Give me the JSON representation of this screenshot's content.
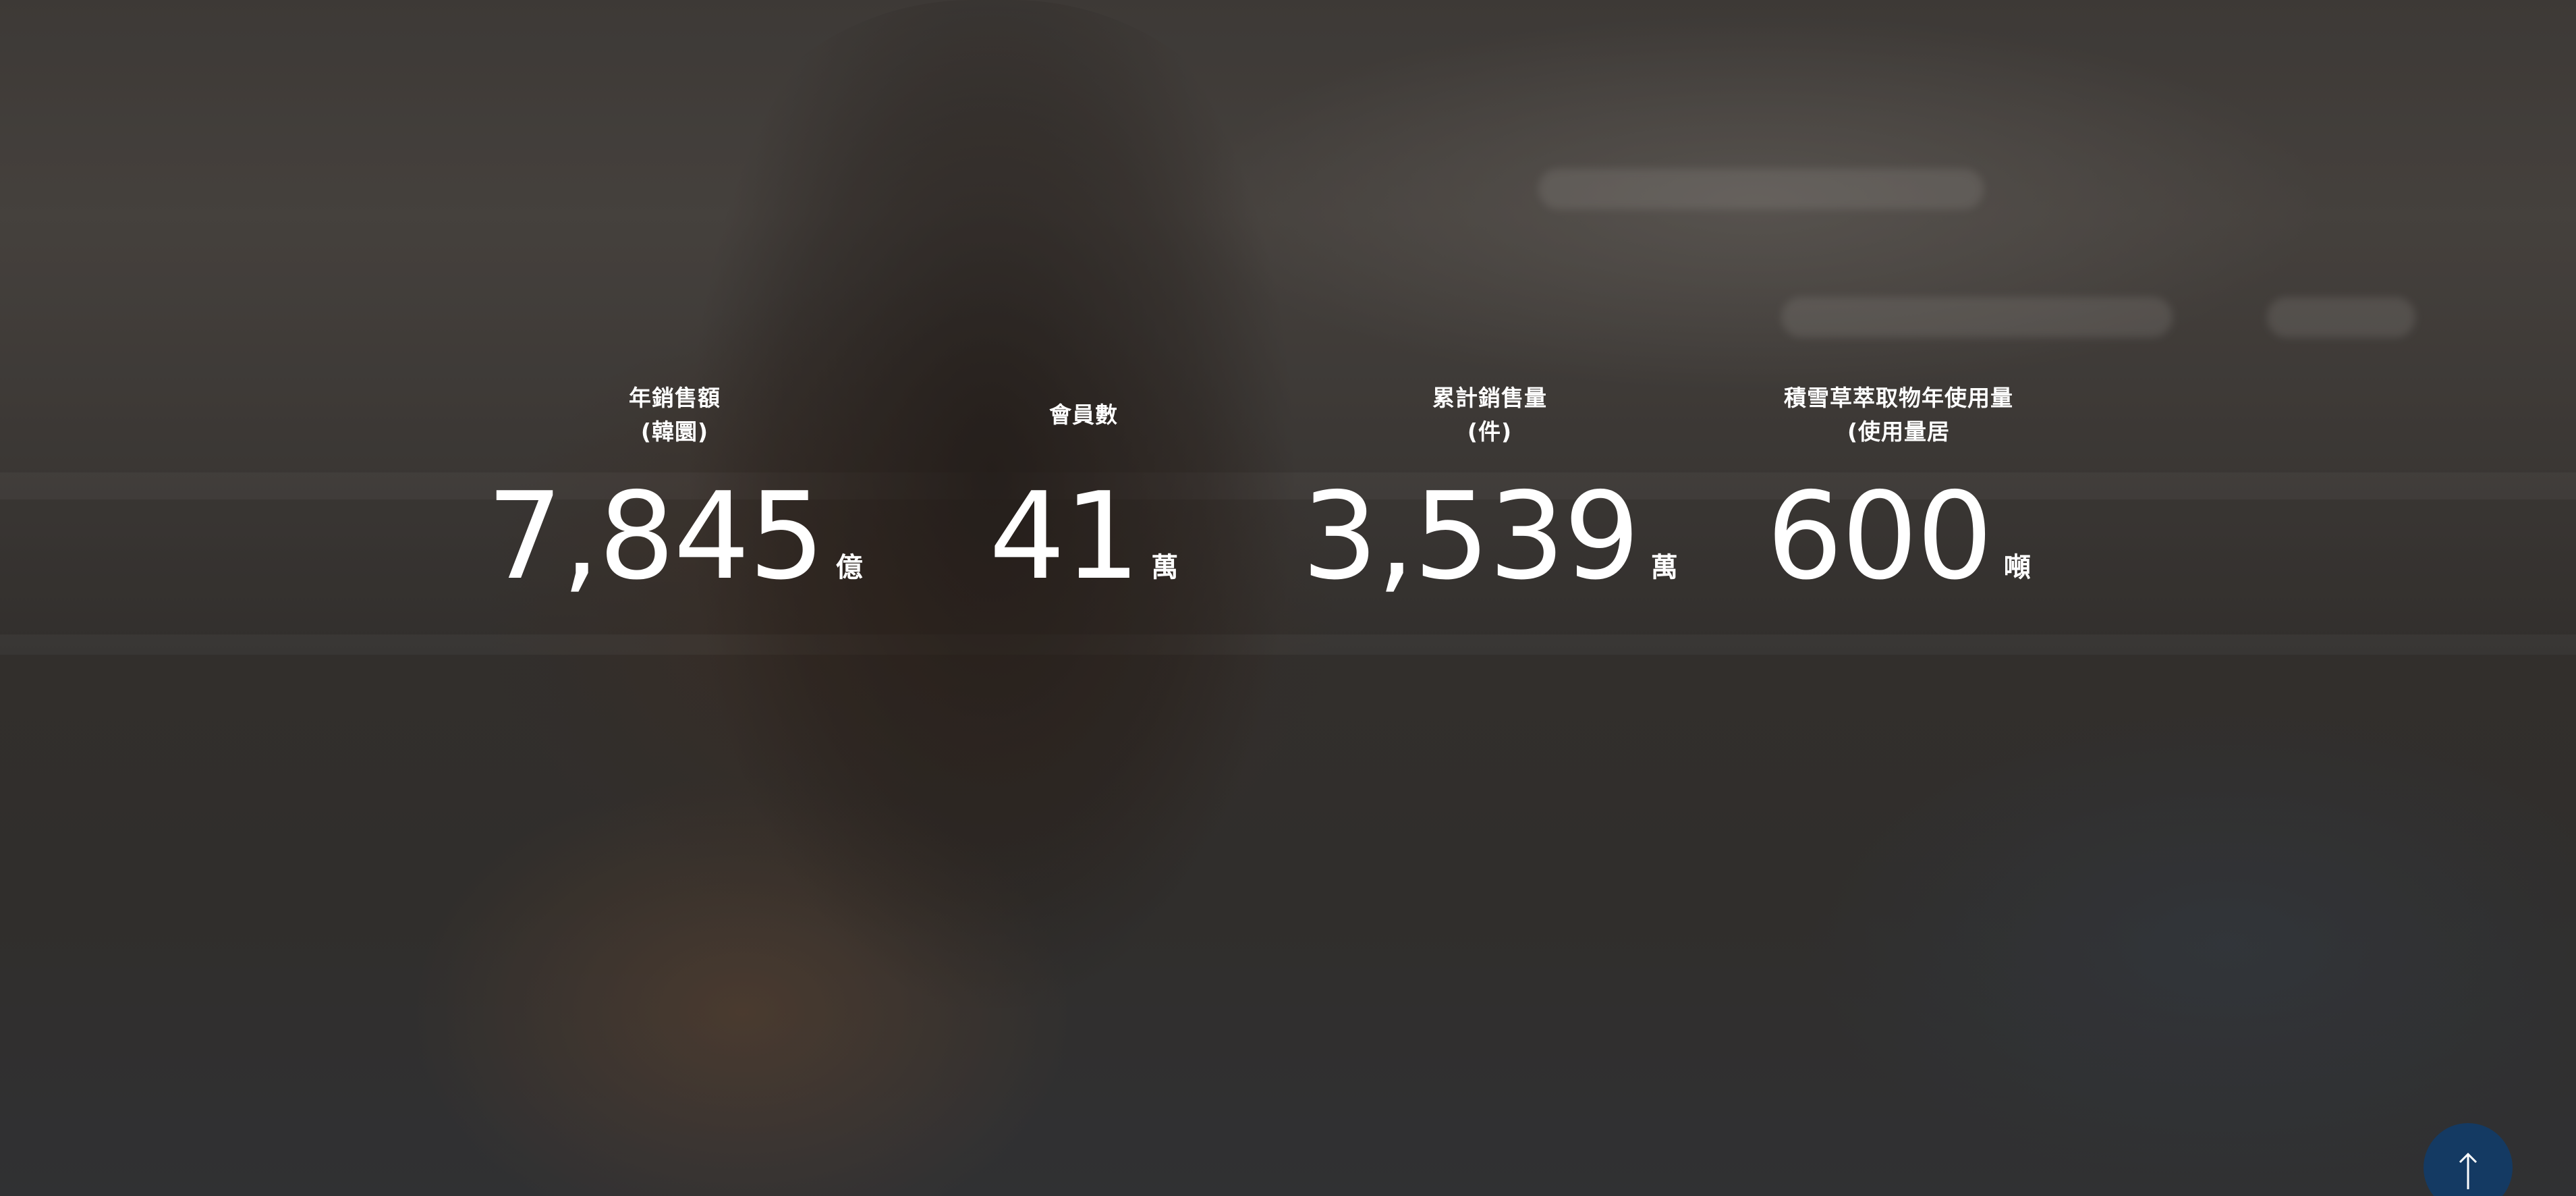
{
  "stats": [
    {
      "label_line1": "年銷售額",
      "label_line2": "(韓圜)",
      "value": "7,845",
      "unit": "億"
    },
    {
      "label_line1": "會員數",
      "label_line2": "",
      "value": "41",
      "unit": "萬"
    },
    {
      "label_line1": "累計銷售量",
      "label_line2": "(件)",
      "value": "3,539",
      "unit": "萬"
    },
    {
      "label_line1": "積雪草萃取物年使用量",
      "label_line2": "(使用量居",
      "value": "600",
      "unit": "噸"
    }
  ],
  "back_to_top": {
    "icon": "arrow-up-icon",
    "color": "#143a63"
  }
}
